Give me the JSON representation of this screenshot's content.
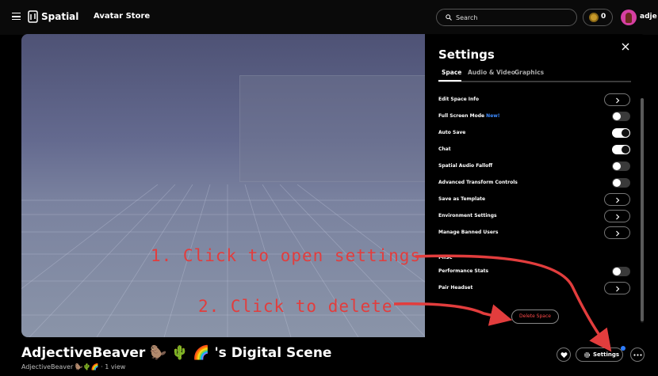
{
  "nav": {
    "logo_text": "Spatial",
    "link_label": "Avatar Store",
    "search_placeholder": "Search",
    "coin_count": "0",
    "username": "adje"
  },
  "settings_panel": {
    "title": "Settings",
    "tabs": [
      {
        "label": "Space",
        "active": true
      },
      {
        "label": "Audio & Video",
        "active": false
      },
      {
        "label": "Graphics",
        "active": false
      }
    ],
    "rows": [
      {
        "label": "Edit Space Info",
        "control": "chevron"
      },
      {
        "label": "Full Screen Mode",
        "badge": "New!",
        "control": "toggle",
        "on": false
      },
      {
        "label": "Auto Save",
        "control": "toggle",
        "on": true
      },
      {
        "label": "Chat",
        "control": "toggle",
        "on": true
      },
      {
        "label": "Spatial Audio Falloff",
        "control": "toggle",
        "on": false
      },
      {
        "label": "Advanced Transform Controls",
        "control": "toggle",
        "on": false
      },
      {
        "label": "Save as Template",
        "control": "chevron"
      },
      {
        "label": "Environment Settings",
        "control": "chevron"
      },
      {
        "label": "Manage Banned Users",
        "control": "chevron"
      },
      {
        "label": "Performance Stats",
        "control": "toggle",
        "on": false
      },
      {
        "label": "Pair Headset",
        "control": "chevron"
      }
    ],
    "section_label": "Misc",
    "delete_label": "Delete Space"
  },
  "footer": {
    "title": "AdjectiveBeaver 🦫 🌵 🌈 's Digital Scene",
    "subtitle": "AdjectiveBeaver 🦫🌵🌈 · 1 view",
    "settings_label": "Settings"
  },
  "annotations": {
    "step1": "1. Click to open settings",
    "step2": "2. Click to delete"
  },
  "colors": {
    "annotation": "#e23d3d",
    "delete_text": "#ff4a4a",
    "new_badge": "#3d8bff",
    "notification_dot": "#2e7dff"
  }
}
